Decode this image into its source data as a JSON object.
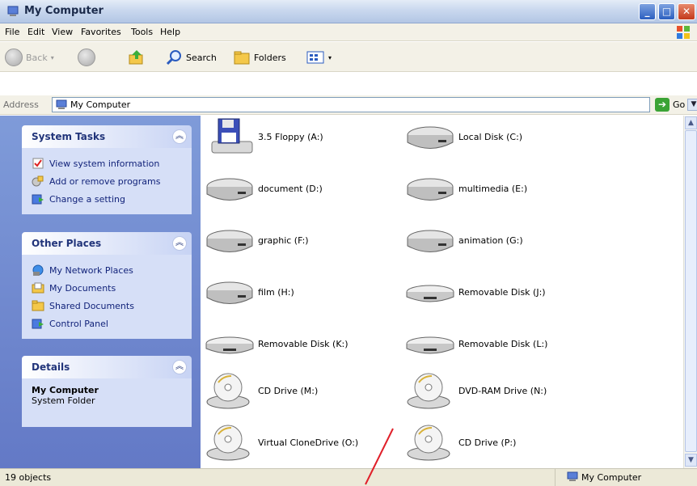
{
  "window": {
    "title": "My Computer"
  },
  "menu": [
    "File",
    "Edit",
    "View",
    "Favorites",
    "Tools",
    "Help"
  ],
  "toolbar": {
    "back": "Back",
    "search": "Search",
    "folders": "Folders"
  },
  "address": {
    "label": "Address",
    "value": "My Computer",
    "go": "Go"
  },
  "tasks": {
    "system": {
      "title": "System Tasks",
      "links": [
        "View system information",
        "Add or remove programs",
        "Change a setting"
      ]
    },
    "other": {
      "title": "Other Places",
      "links": [
        "My Network Places",
        "My Documents",
        "Shared Documents",
        "Control Panel"
      ]
    },
    "details": {
      "title": "Details",
      "name": "My Computer",
      "type": "System Folder"
    }
  },
  "drives": [
    {
      "label": "3.5 Floppy (A:)",
      "icon": "floppy-icon"
    },
    {
      "label": "Local Disk (C:)",
      "icon": "hard-disk-icon"
    },
    {
      "label": "document (D:)",
      "icon": "hard-disk-icon"
    },
    {
      "label": "multimedia (E:)",
      "icon": "hard-disk-icon"
    },
    {
      "label": "graphic (F:)",
      "icon": "hard-disk-icon"
    },
    {
      "label": "animation (G:)",
      "icon": "hard-disk-icon"
    },
    {
      "label": "film (H:)",
      "icon": "hard-disk-icon"
    },
    {
      "label": "Removable Disk (J:)",
      "icon": "removable-disk-icon"
    },
    {
      "label": "Removable Disk (K:)",
      "icon": "removable-disk-icon"
    },
    {
      "label": "Removable Disk (L:)",
      "icon": "removable-disk-icon"
    },
    {
      "label": "CD Drive (M:)",
      "icon": "cd-drive-icon"
    },
    {
      "label": "DVD-RAM Drive (N:)",
      "icon": "cd-drive-icon"
    },
    {
      "label": "Virtual CloneDrive (O:)",
      "icon": "cd-drive-icon"
    },
    {
      "label": "CD Drive (P:)",
      "icon": "cd-drive-icon"
    }
  ],
  "status": {
    "count": "19 objects",
    "zone": "My Computer"
  },
  "colors": {
    "taskpane": "#6f8ad0",
    "link": "#12237a",
    "annotation": "#e0202a"
  }
}
